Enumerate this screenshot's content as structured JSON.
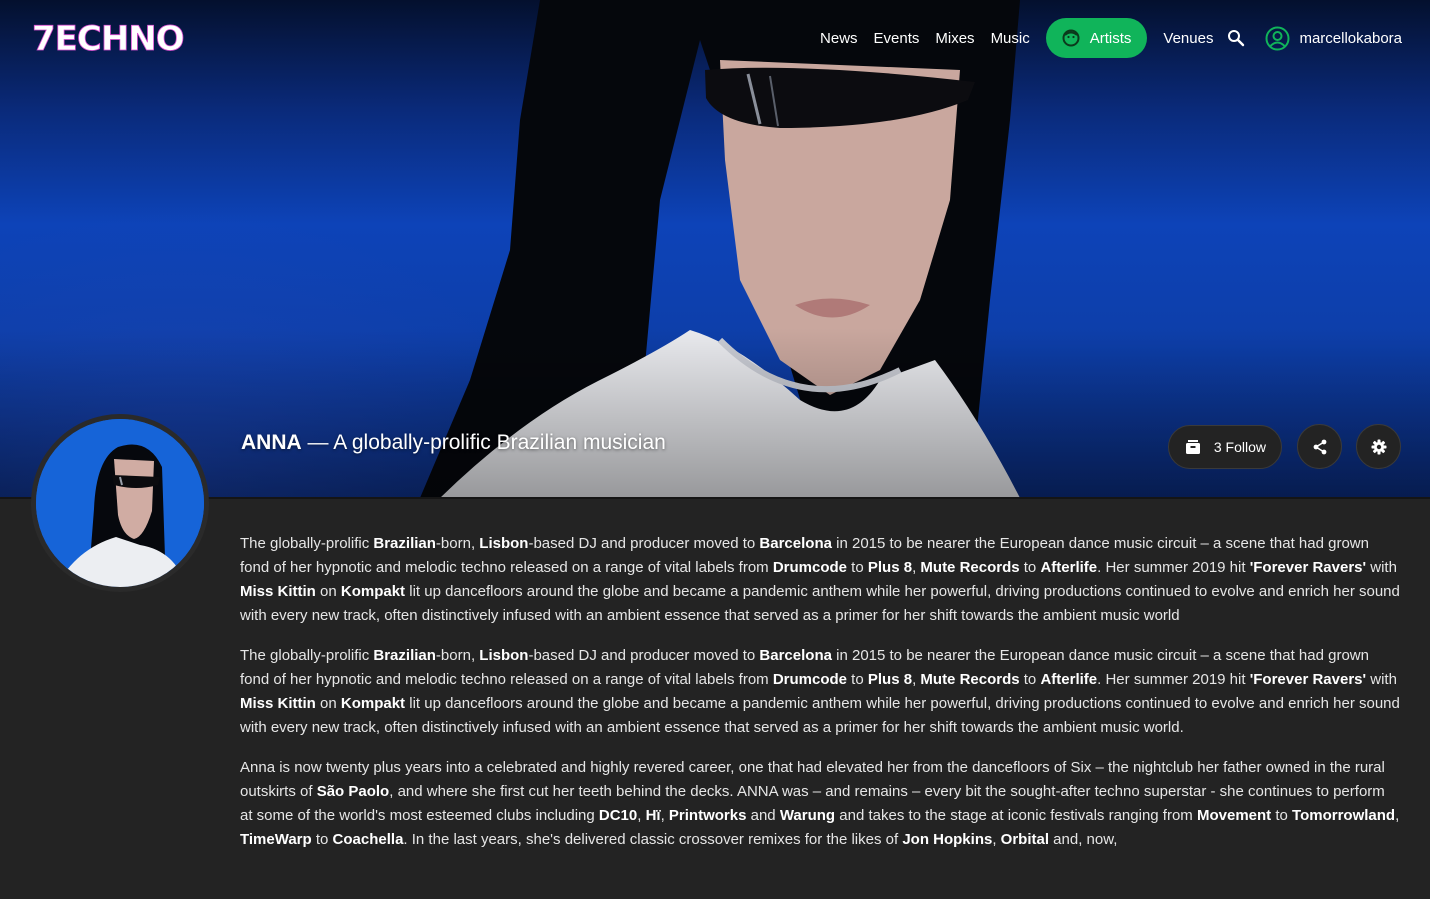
{
  "nav": {
    "logo_text": "7ECHNO",
    "links": [
      "News",
      "Events",
      "Mixes",
      "Music"
    ],
    "artists_label": "Artists",
    "venues_label": "Venues",
    "username": "marcellokabora"
  },
  "artist": {
    "name": "ANNA",
    "tagline": "— A globally-prolific Brazilian musician",
    "follow_label": "3 Follow"
  },
  "bio": {
    "p1": [
      {
        "t": "The globally-prolific "
      },
      {
        "t": "Brazilian",
        "b": true
      },
      {
        "t": "-born, "
      },
      {
        "t": "Lisbon",
        "b": true
      },
      {
        "t": "-based DJ and producer moved to "
      },
      {
        "t": "Barcelona",
        "b": true
      },
      {
        "t": " in 2015 to be nearer the European dance music circuit – a scene that had grown fond of her hypnotic and melodic techno released on a range of vital labels from "
      },
      {
        "t": "Drumcode",
        "b": true
      },
      {
        "t": " to "
      },
      {
        "t": "Plus 8",
        "b": true
      },
      {
        "t": ", "
      },
      {
        "t": "Mute Records",
        "b": true
      },
      {
        "t": " to "
      },
      {
        "t": "Afterlife",
        "b": true
      },
      {
        "t": ". Her summer 2019 hit "
      },
      {
        "t": "'Forever Ravers'",
        "b": true
      },
      {
        "t": " with "
      },
      {
        "t": "Miss Kittin",
        "b": true
      },
      {
        "t": " on "
      },
      {
        "t": "Kompakt",
        "b": true
      },
      {
        "t": " lit up dancefloors around the globe and became a pandemic anthem while her powerful, driving productions continued to evolve and enrich her sound with every new track, often distinctively infused with an ambient essence that served as a primer for her shift towards the ambient music world"
      }
    ],
    "p2": [
      {
        "t": "The globally-prolific "
      },
      {
        "t": "Brazilian",
        "b": true
      },
      {
        "t": "-born, "
      },
      {
        "t": "Lisbon",
        "b": true
      },
      {
        "t": "-based DJ and producer moved to "
      },
      {
        "t": "Barcelona",
        "b": true
      },
      {
        "t": " in 2015 to be nearer the European dance music circuit – a scene that had grown fond of her hypnotic and melodic techno released on a range of vital labels from "
      },
      {
        "t": "Drumcode",
        "b": true
      },
      {
        "t": " to "
      },
      {
        "t": "Plus 8",
        "b": true
      },
      {
        "t": ", "
      },
      {
        "t": "Mute Records",
        "b": true
      },
      {
        "t": " to "
      },
      {
        "t": "Afterlife",
        "b": true
      },
      {
        "t": ". Her summer 2019 hit "
      },
      {
        "t": "'Forever Ravers'",
        "b": true
      },
      {
        "t": " with "
      },
      {
        "t": "Miss Kittin",
        "b": true
      },
      {
        "t": " on "
      },
      {
        "t": "Kompakt",
        "b": true
      },
      {
        "t": " lit up dancefloors around the globe and became a pandemic anthem while her powerful, driving productions continued to evolve and enrich her sound with every new track, often distinctively infused with an ambient essence that served as a primer for her shift towards the ambient music world."
      }
    ],
    "p3": [
      {
        "t": "Anna is now twenty plus years into a celebrated and highly revered career, one that had elevated her from the dancefloors of Six – the nightclub her father owned in the rural outskirts of "
      },
      {
        "t": "São Paolo",
        "b": true
      },
      {
        "t": ", and where she first cut her teeth behind the decks. ANNA was – and remains – every bit the sought-after techno superstar - she continues to perform at some of the world's most esteemed clubs including "
      },
      {
        "t": "DC10",
        "b": true
      },
      {
        "t": ", "
      },
      {
        "t": "Hï",
        "b": true
      },
      {
        "t": ", "
      },
      {
        "t": "Printworks",
        "b": true
      },
      {
        "t": " and "
      },
      {
        "t": "Warung",
        "b": true
      },
      {
        "t": " and takes to the stage at iconic festivals ranging from "
      },
      {
        "t": "Movement",
        "b": true
      },
      {
        "t": " to "
      },
      {
        "t": "Tomorrowland",
        "b": true
      },
      {
        "t": ", "
      },
      {
        "t": "TimeWarp",
        "b": true
      },
      {
        "t": " to "
      },
      {
        "t": "Coachella",
        "b": true
      },
      {
        "t": ". In the last years, she's delivered classic crossover remixes for the likes of "
      },
      {
        "t": "Jon Hopkins",
        "b": true
      },
      {
        "t": ", "
      },
      {
        "t": "Orbital",
        "b": true
      },
      {
        "t": " and, now,"
      }
    ]
  },
  "colors": {
    "accent": "#10b45a",
    "hero_blue": "#0d43b8",
    "page_bg": "#232323"
  },
  "icons": {
    "artists": "face-icon",
    "search": "search-icon",
    "user": "account-circle-icon",
    "follow": "inbox-icon",
    "share": "share-icon",
    "settings": "gear-icon"
  }
}
